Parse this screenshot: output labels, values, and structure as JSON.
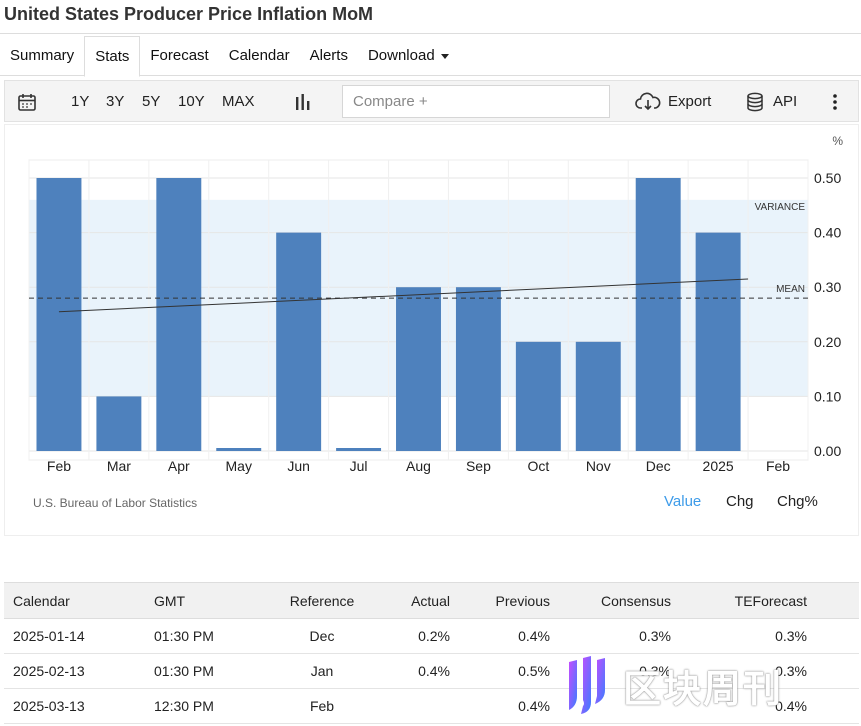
{
  "page": {
    "title": "United States Producer Price Inflation MoM"
  },
  "tabs": [
    {
      "label": "Summary"
    },
    {
      "label": "Stats",
      "active": true
    },
    {
      "label": "Forecast"
    },
    {
      "label": "Calendar"
    },
    {
      "label": "Alerts"
    },
    {
      "label": "Download",
      "dropdown": true
    }
  ],
  "toolbar": {
    "ranges": [
      "1Y",
      "3Y",
      "5Y",
      "10Y",
      "MAX"
    ],
    "compare_placeholder": "Compare +",
    "export_label": "Export",
    "api_label": "API",
    "icons": [
      "calendar-icon",
      "bar-chart-icon",
      "cloud-download-icon",
      "database-icon",
      "more-vertical-icon"
    ]
  },
  "chart_data": {
    "type": "bar",
    "categories": [
      "Feb",
      "Mar",
      "Apr",
      "May",
      "Jun",
      "Jul",
      "Aug",
      "Sep",
      "Oct",
      "Nov",
      "Dec",
      "2025",
      "Feb"
    ],
    "values": [
      0.5,
      0.1,
      0.5,
      0.0,
      0.4,
      0.0,
      0.3,
      0.3,
      0.2,
      0.2,
      0.5,
      0.4,
      null
    ],
    "unit": "%",
    "ylim": [
      0,
      0.5
    ],
    "yticks": [
      "0.00",
      "0.10",
      "0.20",
      "0.30",
      "0.40",
      "0.50"
    ],
    "mean": 0.28,
    "mean_label": "MEAN",
    "variance_range": [
      0.1,
      0.46
    ],
    "variance_label": "VARIANCE",
    "trend": [
      0.255,
      0.315
    ],
    "grid": true,
    "bar_color": "#4e81bd",
    "band_color": "#e9f3fb"
  },
  "source": "U.S. Bureau of Labor Statistics",
  "value_modes": [
    {
      "label": "Value",
      "active": true,
      "color": "#3d9be9"
    },
    {
      "label": "Chg"
    },
    {
      "label": "Chg%"
    }
  ],
  "calendar": {
    "headers": [
      "Calendar",
      "GMT",
      "Reference",
      "Actual",
      "Previous",
      "Consensus",
      "TEForecast"
    ],
    "rows": [
      [
        "2025-01-14",
        "01:30 PM",
        "Dec",
        "0.2%",
        "0.4%",
        "0.3%",
        "0.3%"
      ],
      [
        "2025-02-13",
        "01:30 PM",
        "Jan",
        "0.4%",
        "0.5%",
        "0.3%",
        "0.3%"
      ],
      [
        "2025-03-13",
        "12:30 PM",
        "Feb",
        "",
        "0.4%",
        "",
        "0.4%"
      ]
    ]
  },
  "watermark": {
    "text": "区块周刊"
  }
}
